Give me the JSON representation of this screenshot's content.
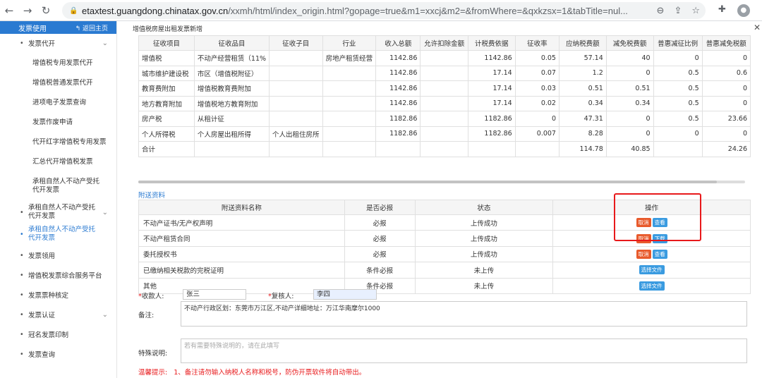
{
  "browser": {
    "url_host": "etaxtest.guangdong.chinatax.gov.cn",
    "url_path": "/xxmh/html/index_origin.html?gopage=true&m1=xxcj&m2=&fromWhere=&qxkzsx=1&tabTitle=nul..."
  },
  "sidebar": {
    "header": "发票使用",
    "back": "返回主页",
    "items": [
      {
        "label": "发票代开",
        "type": "top",
        "chev": true
      },
      {
        "label": "增值税专用发票代开",
        "type": "sub"
      },
      {
        "label": "增值税普通发票代开",
        "type": "sub"
      },
      {
        "label": "进项电子发票查询",
        "type": "sub"
      },
      {
        "label": "发票作废申请",
        "type": "sub"
      },
      {
        "label": "代开红字增值税专用发票",
        "type": "sub"
      },
      {
        "label": "汇总代开增值税发票",
        "type": "sub"
      },
      {
        "label": "承租自然人不动产受托代开发票",
        "type": "sub"
      },
      {
        "label": "承租自然人不动产受托代开发票",
        "type": "top",
        "chev": true
      },
      {
        "label": "承租自然人不动产受托代开发票",
        "type": "top",
        "active": true
      },
      {
        "label": "发票领用",
        "type": "top"
      },
      {
        "label": "增值税发票综合服务平台",
        "type": "top"
      },
      {
        "label": "发票票种核定",
        "type": "top"
      },
      {
        "label": "发票认证",
        "type": "top",
        "chev": true
      },
      {
        "label": "冠名发票印制",
        "type": "top"
      },
      {
        "label": "发票查询",
        "type": "top"
      }
    ]
  },
  "page": {
    "title": "增值税房屋出租发票新增"
  },
  "tax_table": {
    "headers": [
      "征收项目",
      "征收品目",
      "征收子目",
      "行业",
      "收入总额",
      "允许扣除金额",
      "计税费依据",
      "征收率",
      "应纳税费额",
      "减免税费额",
      "普惠减征比例",
      "普惠减免税额"
    ],
    "rows": [
      [
        "增值税",
        "不动产经营租赁（11%",
        "",
        "房地产租赁经营",
        "1142.86",
        "",
        "1142.86",
        "0.05",
        "57.14",
        "40",
        "0",
        "0"
      ],
      [
        "城市维护建设税",
        "市区（增值税附征）",
        "",
        "",
        "1142.86",
        "",
        "17.14",
        "0.07",
        "1.2",
        "0",
        "0.5",
        "0.6"
      ],
      [
        "教育费附加",
        "增值税教育费附加",
        "",
        "",
        "1142.86",
        "",
        "17.14",
        "0.03",
        "0.51",
        "0.51",
        "0.5",
        "0"
      ],
      [
        "地方教育附加",
        "增值税地方教育附加",
        "",
        "",
        "1142.86",
        "",
        "17.14",
        "0.02",
        "0.34",
        "0.34",
        "0.5",
        "0"
      ],
      [
        "房产税",
        "从租计征",
        "",
        "",
        "1182.86",
        "",
        "1182.86",
        "0",
        "47.31",
        "0",
        "0.5",
        "23.66"
      ],
      [
        "个人所得税",
        "个人房屋出租所得",
        "个人出租住房所",
        "",
        "1182.86",
        "",
        "1182.86",
        "0.007",
        "8.28",
        "0",
        "0",
        "0"
      ],
      [
        "合计",
        "",
        "",
        "",
        "",
        "",
        "",
        "",
        "114.78",
        "40.85",
        "",
        "24.26"
      ]
    ]
  },
  "attachments": {
    "title": "附送资料",
    "headers": [
      "附送资料名称",
      "是否必报",
      "状态",
      "操作"
    ],
    "rows": [
      {
        "name": "不动产证书/无产权声明",
        "required": "必报",
        "status": "上传成功",
        "actions": [
          {
            "label": "取消",
            "color": "red"
          },
          {
            "label": "查看",
            "color": "blue"
          }
        ]
      },
      {
        "name": "不动产租赁合同",
        "required": "必报",
        "status": "上传成功",
        "actions": [
          {
            "label": "取消",
            "color": "red"
          },
          {
            "label": "下载",
            "color": "blue"
          }
        ]
      },
      {
        "name": "委托授权书",
        "required": "必报",
        "status": "上传成功",
        "actions": [
          {
            "label": "取消",
            "color": "red"
          },
          {
            "label": "查看",
            "color": "blue"
          }
        ]
      },
      {
        "name": "已缴纳相关税款的完税证明",
        "required": "条件必报",
        "status": "未上传",
        "actions": [
          {
            "label": "选择文件",
            "color": "blue"
          }
        ]
      },
      {
        "name": "其他",
        "required": "条件必报",
        "status": "未上传",
        "actions": [
          {
            "label": "选择文件",
            "color": "blue"
          }
        ]
      }
    ]
  },
  "form": {
    "payee_label": "收款人:",
    "payee_value": "张三",
    "reviewer_label": "复核人:",
    "reviewer_value": "李四",
    "remark_label": "备注:",
    "remark_value": "不动产行政区划：东莞市万江区,不动产详细地址：万江华南摩尔1000",
    "special_label": "特殊说明:",
    "special_placeholder": "若有需要特殊说明的，请在此填写",
    "warn_label": "温馨提示:",
    "warn_text": "1、备注请勿输入纳税人名称和税号，防伪开票软件将自动带出。"
  }
}
